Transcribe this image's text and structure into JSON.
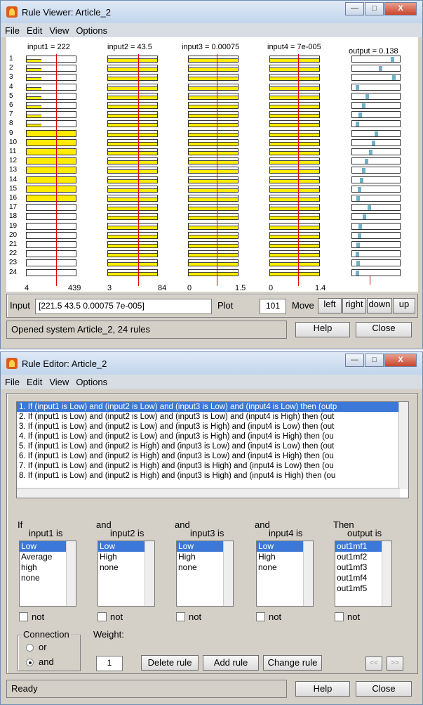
{
  "viewer": {
    "title": "Rule Viewer: Article_2",
    "menu": [
      "File",
      "Edit",
      "View",
      "Options"
    ],
    "headers": [
      "input1 = 222",
      "input2 = 43.5",
      "input3 = 0.00075",
      "input4 = 7e-005",
      "output = 0.138"
    ],
    "row_numbers": [
      "1",
      "2",
      "3",
      "4",
      "5",
      "6",
      "7",
      "8",
      "9",
      "10",
      "11",
      "12",
      "13",
      "14",
      "15",
      "16",
      "17",
      "18",
      "19",
      "20",
      "21",
      "22",
      "23",
      "24"
    ],
    "axis_labels": {
      "in1_min": "4",
      "in1_max": "439",
      "in2_min": "3",
      "in2_max": "84",
      "in3_min": "0",
      "in3_max": "1.5",
      "in4_min": "0",
      "in4_max": "1.4"
    },
    "input_label": "Input",
    "input_value": "[221.5 43.5 0.00075 7e-005]",
    "plot_label": "Plot",
    "plot_value": "101",
    "move_label": "Move",
    "move_buttons": [
      "left",
      "right",
      "down",
      "up"
    ],
    "status": "Opened system Article_2, 24 rules",
    "help": "Help",
    "close": "Close",
    "input1_fill_fraction": [
      0.15,
      0.15,
      0.15,
      0.15,
      0.15,
      0.15,
      0.15,
      0.15,
      1,
      1,
      1,
      1,
      1,
      1,
      1,
      1,
      0,
      0,
      0,
      0,
      0,
      0,
      0,
      0
    ],
    "output_mark_fraction": [
      0.88,
      0.6,
      0.9,
      0.08,
      0.3,
      0.22,
      0.15,
      0.08,
      0.5,
      0.45,
      0.38,
      0.28,
      0.22,
      0.18,
      0.12,
      0.1,
      0.35,
      0.24,
      0.14,
      0.12,
      0.1,
      0.08,
      0.1,
      0.08
    ]
  },
  "editor": {
    "title": "Rule Editor: Article_2",
    "menu": [
      "File",
      "Edit",
      "View",
      "Options"
    ],
    "rules": [
      "1. If (input1 is Low) and (input2 is Low) and (input3 is Low) and (input4 is Low) then (outp",
      "2. If (input1 is Low) and (input2 is Low) and (input3 is Low) and (input4 is High) then (out",
      "3. If (input1 is Low) and (input2 is Low) and (input3 is High) and (input4 is Low) then (out",
      "4. If (input1 is Low) and (input2 is Low) and (input3 is High) and (input4 is High) then (ou",
      "5. If (input1 is Low) and (input2 is High) and (input3 is Low) and (input4 is Low) then (out",
      "6. If (input1 is Low) and (input2 is High) and (input3 is Low) and (input4 is High) then (ou",
      "7. If (input1 is Low) and (input2 is High) and (input3 is High) and (input4 is Low) then (ou",
      "8. If (input1 is Low) and (input2 is High) and (input3 is High) and (input4 is High) then (ou"
    ],
    "if_label": "If",
    "and_label": "and",
    "then_label": "Then",
    "input1_is": "input1 is",
    "input2_is": "input2 is",
    "input3_is": "input3 is",
    "input4_is": "input4 is",
    "output_is": "output is",
    "input1_opts": [
      "Low",
      "Average",
      "high",
      "none"
    ],
    "input2_opts": [
      "Low",
      "High",
      "none"
    ],
    "input3_opts": [
      "Low",
      "High",
      "none"
    ],
    "input4_opts": [
      "Low",
      "High",
      "none"
    ],
    "output_opts": [
      "out1mf1",
      "out1mf2",
      "out1mf3",
      "out1mf4",
      "out1mf5"
    ],
    "not_label": "not",
    "connection_label": "Connection",
    "or_label": "or",
    "and_radio_label": "and",
    "weight_label": "Weight:",
    "weight_value": "1",
    "delete_rule": "Delete rule",
    "add_rule": "Add rule",
    "change_rule": "Change rule",
    "prev_label": "<<",
    "next_label": ">>",
    "status": "Ready",
    "help": "Help",
    "close": "Close"
  }
}
